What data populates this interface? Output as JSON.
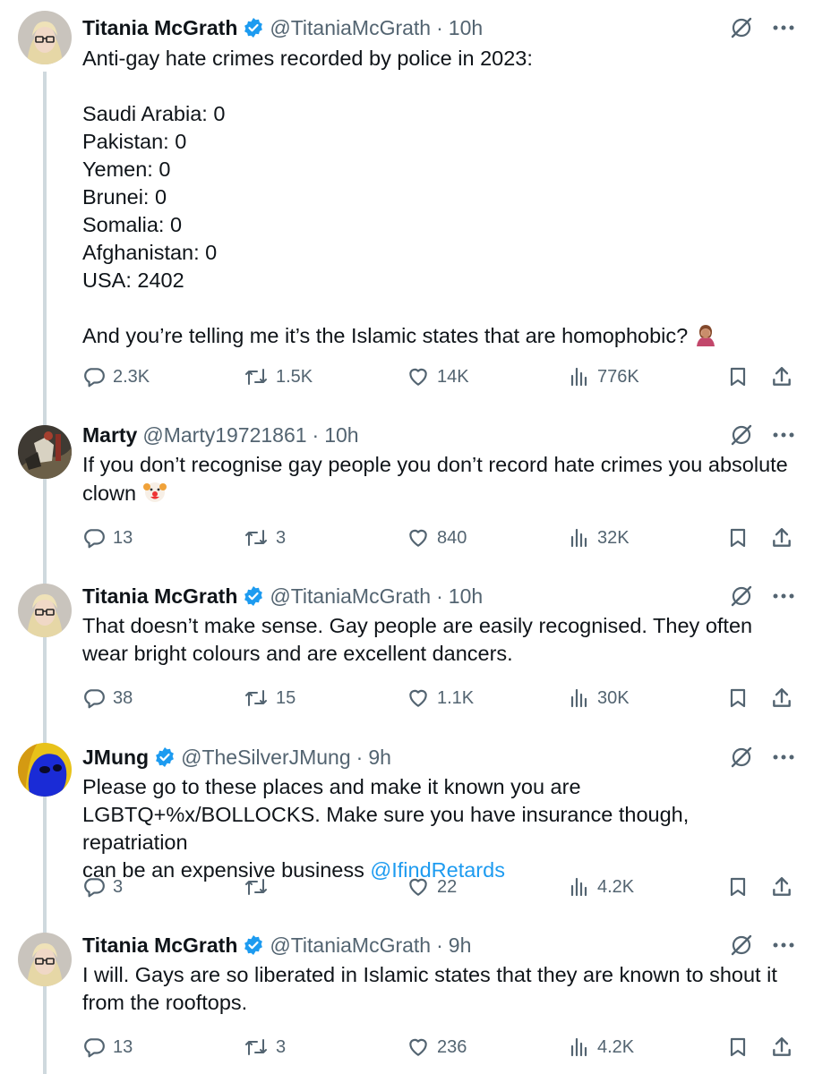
{
  "tweets": [
    {
      "name": "Titania McGrath",
      "verified": true,
      "handle": "@TitaniaMcGrath",
      "time": "10h",
      "lines": [
        "Anti-gay hate crimes recorded by police in 2023:",
        "",
        "Saudi Arabia: 0",
        "Pakistan: 0",
        "Yemen: 0",
        "Brunei: 0",
        "Somalia: 0",
        "Afghanistan: 0",
        "USA: 2402",
        "",
        "And you’re telling me it’s the Islamic states that are homophobic?"
      ],
      "emoji": "facepalm-emoji",
      "replies": "2.3K",
      "retweets": "1.5K",
      "likes": "14K",
      "views": "776K"
    },
    {
      "name": "Marty",
      "verified": false,
      "handle": "@Marty19721861",
      "time": "10h",
      "lines": [
        "If you don’t recognise gay people you don’t record hate crimes you absolute",
        "clown"
      ],
      "emoji": "clown-emoji",
      "replies": "13",
      "retweets": "3",
      "likes": "840",
      "views": "32K"
    },
    {
      "name": "Titania McGrath",
      "verified": true,
      "handle": "@TitaniaMcGrath",
      "time": "10h",
      "lines": [
        "That doesn’t make sense. Gay people are easily recognised. They often",
        "wear bright colours and are excellent dancers."
      ],
      "replies": "38",
      "retweets": "15",
      "likes": "1.1K",
      "views": "30K"
    },
    {
      "name": "JMung",
      "verified": true,
      "handle": "@TheSilverJMung",
      "time": "9h",
      "lines": [
        "Please go to these places and make it known you are",
        "LGBTQ+%x/BOLLOCKS. Make sure you have insurance though, repatriation",
        "can be an expensive business "
      ],
      "mention": "@IfindRetards",
      "replies": "3",
      "retweets": "",
      "likes": "22",
      "views": "4.2K"
    },
    {
      "name": "Titania McGrath",
      "verified": true,
      "handle": "@TitaniaMcGrath",
      "time": "9h",
      "lines": [
        "I will. Gays are so liberated in Islamic states that they are known to shout it",
        "from the rooftops."
      ],
      "replies": "13",
      "retweets": "3",
      "likes": "236",
      "views": "4.2K"
    }
  ],
  "colors": {
    "text": "#0f1419",
    "muted": "#536471",
    "verified": "#1d9bf0",
    "link": "#1d9bf0",
    "thread": "#cfd9de"
  },
  "icons": [
    "reply-icon",
    "retweet-icon",
    "like-icon",
    "views-icon",
    "bookmark-icon",
    "share-icon",
    "grok-icon",
    "more-icon",
    "verified-badge-icon"
  ]
}
